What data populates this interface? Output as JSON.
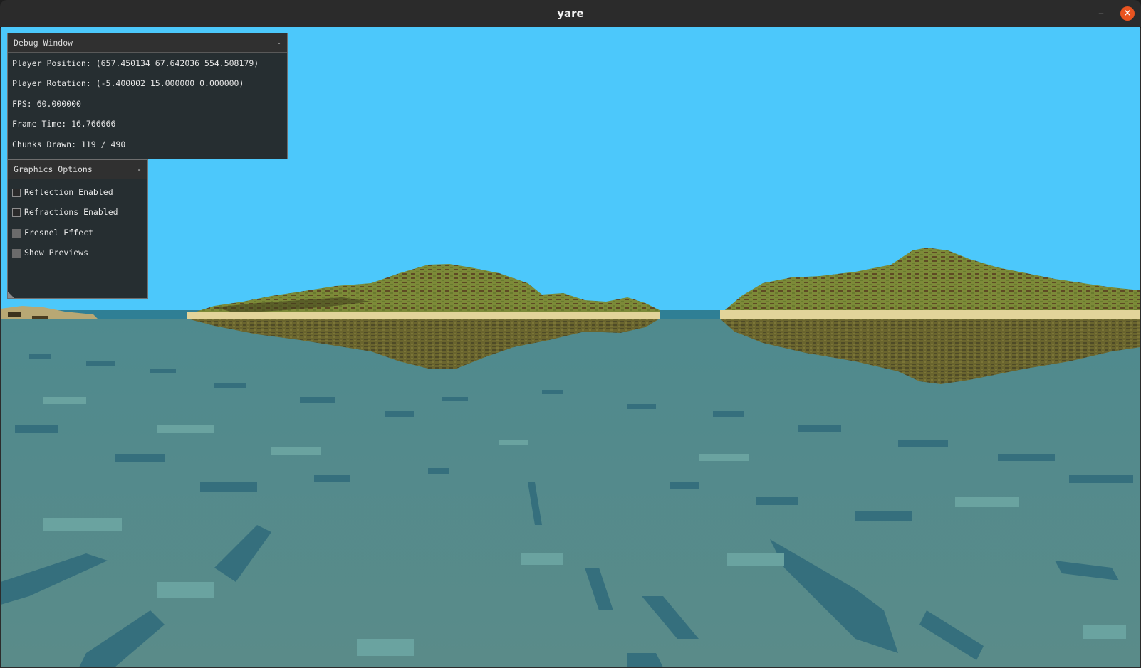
{
  "window": {
    "title": "yare",
    "minimize_symbol": "–",
    "close_symbol": "✕"
  },
  "colors": {
    "sky": "#4cc8fb",
    "water": "#5a8c8c",
    "water_shadow": "#356f7d",
    "water_highlight": "#6aa3a0",
    "grass": "#7c8a38",
    "dirt": "#5e4a24",
    "sand": "#e2d49a",
    "close_button": "#e95420"
  },
  "debug_window": {
    "title": "Debug Window",
    "collapse_symbol": "-",
    "lines": [
      "Player Position: (657.450134 67.642036 554.508179)",
      "Player Rotation: (-5.400002 15.000000 0.000000)",
      "FPS: 60.000000",
      "Frame Time: 16.766666",
      "Chunks Drawn: 119 / 490"
    ]
  },
  "graphics_options": {
    "title": "Graphics Options",
    "collapse_symbol": "-",
    "options": [
      {
        "label": "Reflection Enabled",
        "checked": false
      },
      {
        "label": "Refractions Enabled",
        "checked": false
      },
      {
        "label": "Fresnel Effect",
        "checked": true
      },
      {
        "label": "Show Previews",
        "checked": true
      }
    ]
  }
}
